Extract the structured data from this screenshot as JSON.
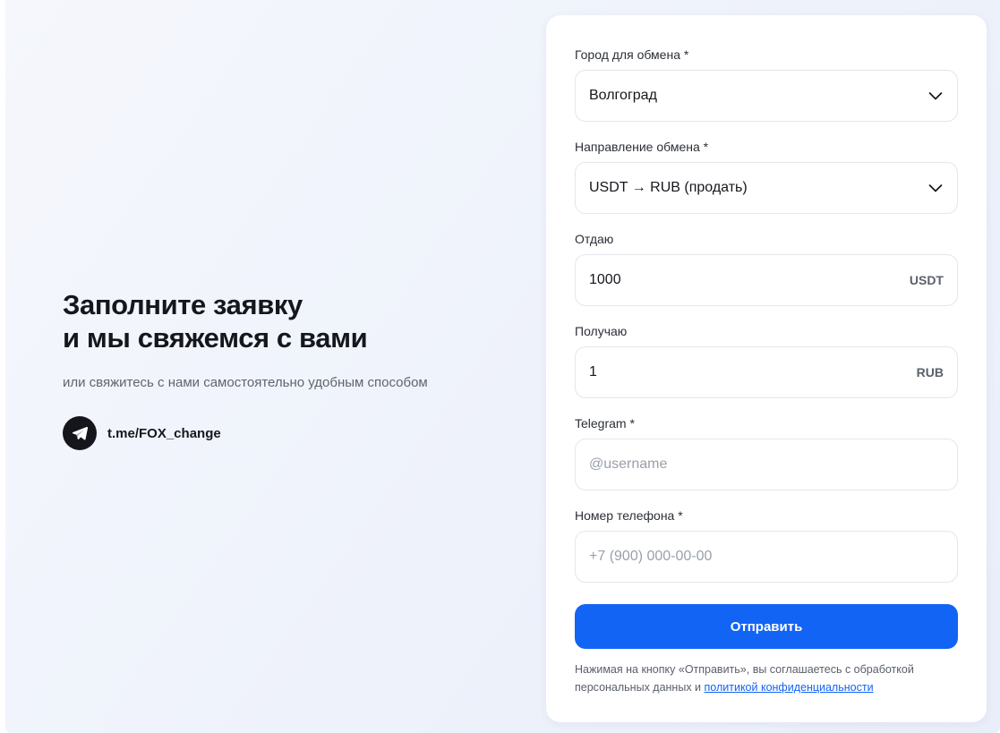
{
  "intro": {
    "title_line1": "Заполните заявку",
    "title_line2": "и мы свяжемся с вами",
    "subtitle": "или свяжитесь с нами самостоятельно удобным способом",
    "contact": {
      "icon": "telegram-icon",
      "label": "t.me/FOX_change"
    }
  },
  "form": {
    "city": {
      "label": "Город для обмена *",
      "value": "Волгоград",
      "icon": "chevron-down-icon"
    },
    "direction": {
      "label": "Направление обмена *",
      "value": "USDT → RUB (продать)",
      "icon": "chevron-down-icon"
    },
    "give": {
      "label": "Отдаю",
      "value": "1000",
      "unit": "USDT"
    },
    "receive": {
      "label": "Получаю",
      "value": "1",
      "unit": "RUB"
    },
    "telegram": {
      "label": "Telegram *",
      "value": "",
      "placeholder": "@username"
    },
    "phone": {
      "label": "Номер телефона *",
      "value": "",
      "placeholder": "+7 (900) 000-00-00"
    },
    "submit_label": "Отправить",
    "consent": {
      "text": "Нажимая на кнопку «Отправить», вы соглашаетесь с обработкой персональных данных и",
      "link_text": "политикой конфиденциальности"
    }
  },
  "colors": {
    "accent": "#1264f5",
    "text": "#15171c",
    "muted": "#5a606b",
    "border": "#e3e6ec",
    "background": "#eef2fb"
  }
}
